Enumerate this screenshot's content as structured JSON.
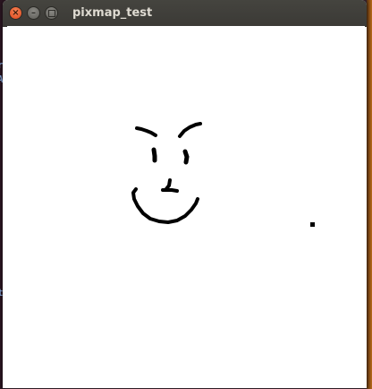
{
  "window": {
    "title": "pixmap_test",
    "controls": {
      "close_icon": "close-icon",
      "minimize_icon": "minimize-icon",
      "maximize_icon": "maximize-icon"
    }
  },
  "desktop": {
    "fragments": [
      "rt",
      "AB",
      "t"
    ]
  },
  "canvas": {
    "background": "#ffffff",
    "stroke_color": "#000000",
    "drawing": "smiley-face"
  }
}
